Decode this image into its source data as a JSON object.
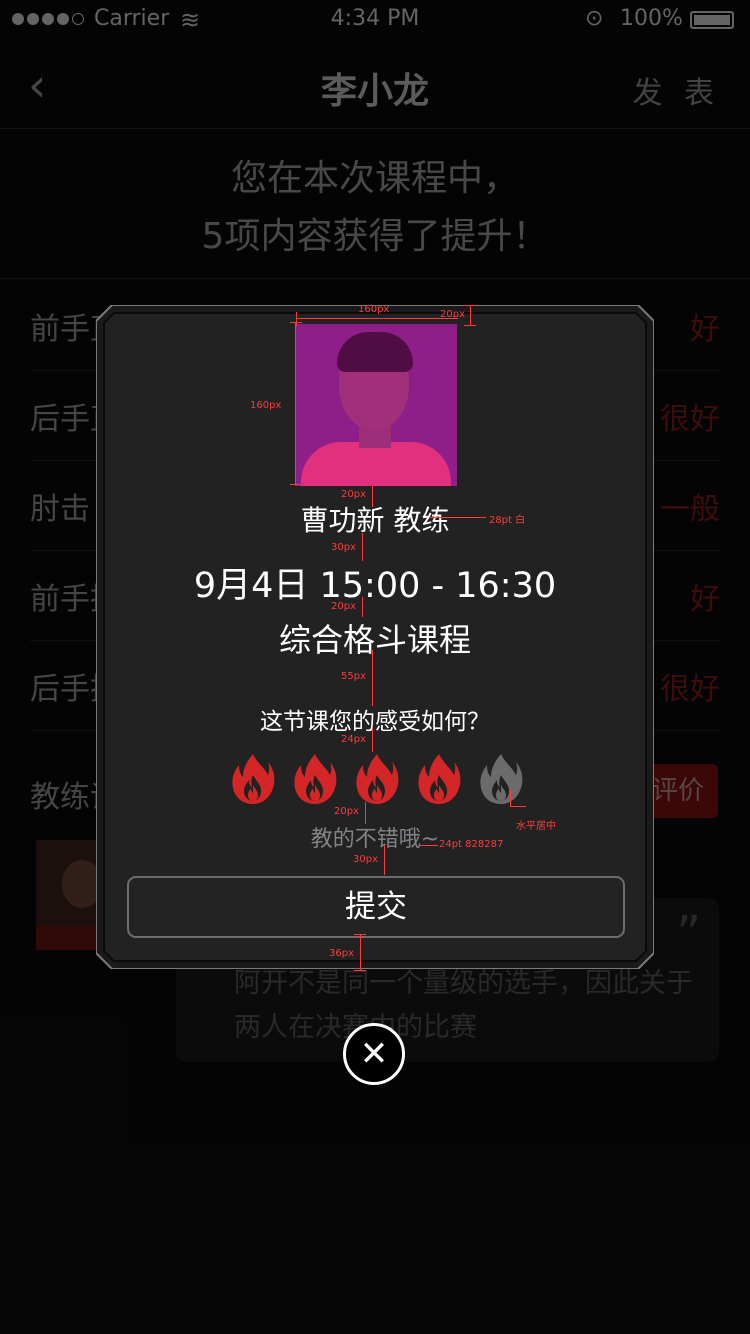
{
  "status_bar": {
    "carrier": "Carrier",
    "time": "4:34 PM",
    "battery": "100%"
  },
  "nav": {
    "back_icon": "chevron-left-icon",
    "title": "李小龙",
    "publish_label": "发 表"
  },
  "summary": {
    "line1": "您在本次课程中，",
    "line2": "5项内容获得了提升！"
  },
  "ratings": [
    {
      "label": "前手直拳",
      "value": "好"
    },
    {
      "label": "后手直拳",
      "value": "很好"
    },
    {
      "label": "肘击",
      "value": "一般"
    },
    {
      "label": "前手摆拳",
      "value": "好"
    },
    {
      "label": "后手摆拳",
      "value": "很好"
    }
  ],
  "coach_section": {
    "label": "教练评价",
    "evaluate_button": "评价"
  },
  "comment_card": {
    "quote_mark": "”",
    "text": "阿开不是同一个量级的选手，因此关于两人在决赛中的比赛"
  },
  "dialog": {
    "coach_name": "曹功新 教练",
    "time_line": "9月4日  15:00 - 16:30",
    "course_name": "综合格斗课程",
    "question": "这节课您的感受如何？",
    "rating": {
      "value": 4,
      "max": 5,
      "active_color": "#d42626",
      "inactive_color": "#6b6b6b"
    },
    "rating_caption": "教的不错哦~",
    "submit_label": "提交",
    "close_icon": "close-icon"
  },
  "annotations": {
    "w160": "160px",
    "h160": "160px",
    "top20": "20px",
    "gap20a": "20px",
    "name_spec": "28pt 白",
    "gap30a": "30px",
    "gap20b": "20px",
    "gap55": "55px",
    "gap24": "24px",
    "center_note": "水平居中",
    "gap20c": "20px",
    "caption_spec": "24pt 828287",
    "gap30b": "30px",
    "gap36": "36px"
  }
}
